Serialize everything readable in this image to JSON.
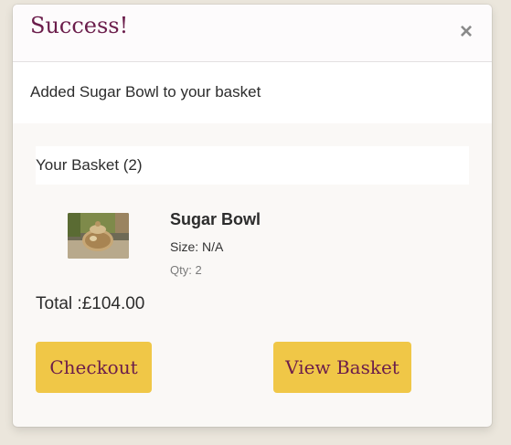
{
  "toast": {
    "title": "Success!",
    "close_label": "×",
    "message": "Added Sugar Bowl to your basket"
  },
  "basket": {
    "header_label": "Your Basket (2)",
    "item": {
      "name": "Sugar Bowl",
      "size": "Size: N/A",
      "qty": "Qty: 2",
      "image_icon": "sugar-bowl-photo"
    },
    "total": "Total :£104.00",
    "checkout_label": "Checkout",
    "view_basket_label": "View Basket"
  },
  "colors": {
    "page_bg": "#ebe6dc",
    "title": "#6b1d4b",
    "button_bg": "#f0c747",
    "button_text": "#6b1d4b"
  }
}
